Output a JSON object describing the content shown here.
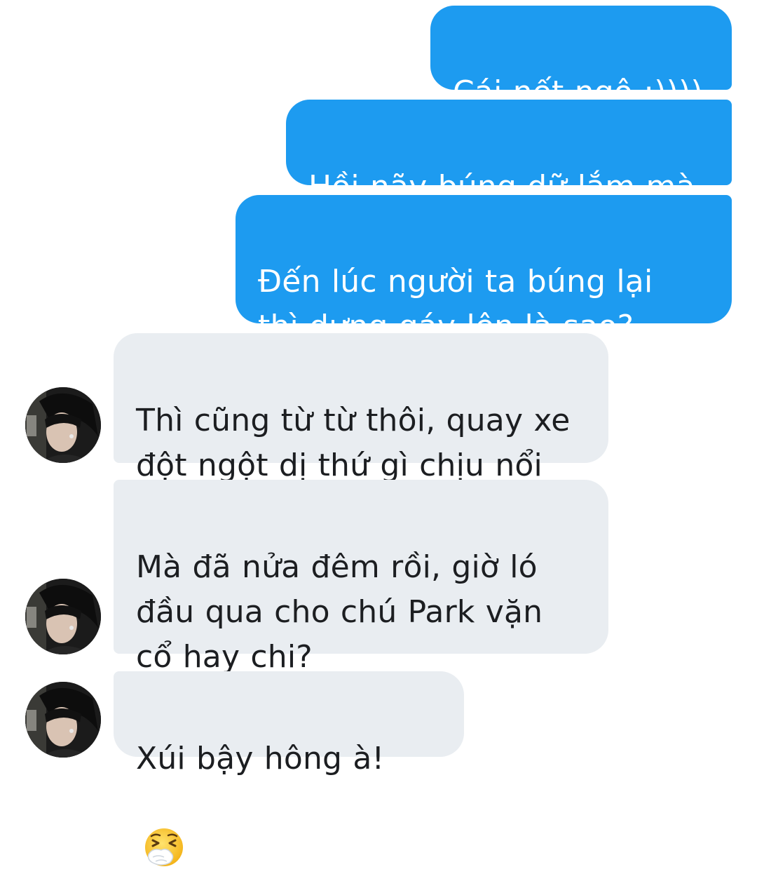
{
  "messages": [
    {
      "direction": "sent",
      "text": "Cái nết ngộ :))))"
    },
    {
      "direction": "sent",
      "text": "Hồi nãy búng dữ lắm mà"
    },
    {
      "direction": "sent",
      "text": "Đến lúc người ta búng lại\nthì dựng gáy lên là sao?"
    },
    {
      "direction": "received",
      "text": "Thì cũng từ từ thôi, quay xe\nđột ngột dị thứ gì chịu nổi"
    },
    {
      "direction": "received",
      "text": "Mà đã nửa đêm rồi, giờ ló\nđầu qua cho chú Park vặn\ncổ hay chi?"
    },
    {
      "direction": "received",
      "text": "Xúi bậy hông à!",
      "emoji": "sneezing-face-emoji"
    }
  ],
  "colors": {
    "sent_bubble": "#1d9bf0",
    "sent_text": "#ffffff",
    "received_bubble": "#e9edf1",
    "received_text": "#1c1e21",
    "background": "#ffffff"
  }
}
